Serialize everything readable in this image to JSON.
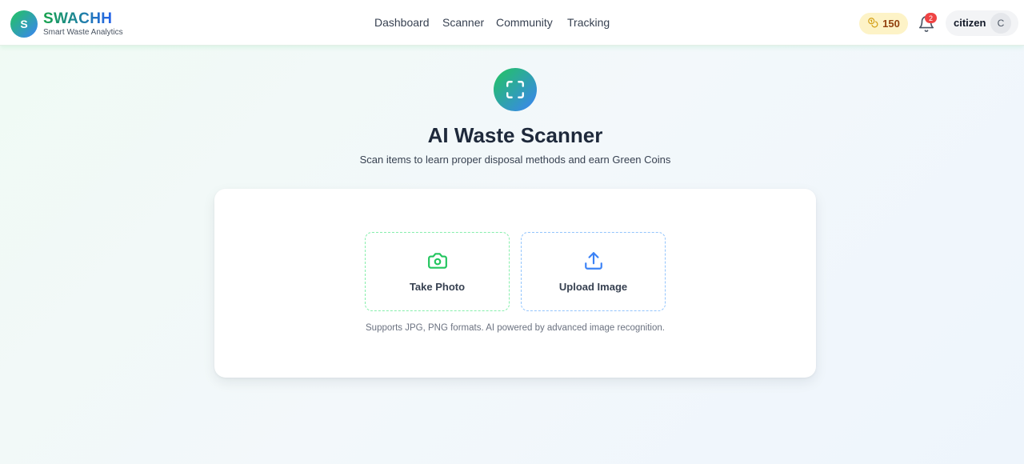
{
  "header": {
    "logo_letter": "S",
    "brand_name": "SWACHH",
    "brand_tagline": "Smart Waste Analytics",
    "nav": [
      {
        "label": "Dashboard",
        "icon": ""
      },
      {
        "label": "Scanner",
        "icon": ""
      },
      {
        "label": "Community",
        "icon": ""
      },
      {
        "label": "Tracking",
        "icon": ""
      }
    ],
    "coins": {
      "value": "150",
      "icon": "coins-icon"
    },
    "notifications": {
      "count": "2",
      "icon": "bell-icon"
    },
    "user": {
      "name": "citizen",
      "avatar_initial": "C"
    }
  },
  "main": {
    "hero_icon": "scan-icon",
    "title": "AI Waste Scanner",
    "subtitle": "Scan items to learn proper disposal methods and earn Green Coins",
    "options": [
      {
        "label": "Take Photo",
        "icon": "camera-icon",
        "color": "#22c55e"
      },
      {
        "label": "Upload Image",
        "icon": "upload-icon",
        "color": "#3b82f6"
      }
    ],
    "note": "Supports JPG, PNG formats. AI powered by advanced image recognition."
  },
  "colors": {
    "accent_green": "#22c55e",
    "accent_blue": "#3b82f6",
    "coin_bg": "#fdf3c7",
    "badge_red": "#ef4444"
  }
}
